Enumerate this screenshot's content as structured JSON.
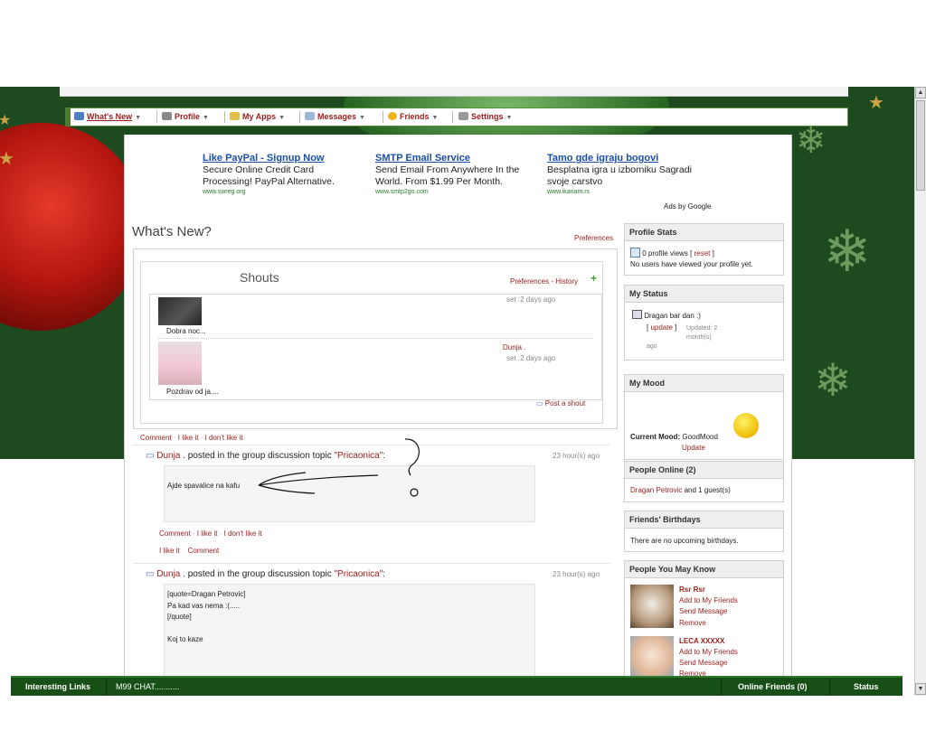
{
  "menubar": {
    "whats_new": "What's New",
    "profile": "Profile",
    "my_apps": "My Apps",
    "messages": "Messages",
    "friends": "Friends",
    "settings": "Settings"
  },
  "ads": [
    {
      "title": "Like PayPal - Signup Now",
      "text1": "Secure Online Credit Card",
      "text2": "Processing! PayPal Alternative.",
      "url": "www.swreg.org"
    },
    {
      "title": "SMTP Email Service",
      "text1": "Send Email From Anywhere In the",
      "text2": "World. From $1.99 Per Month.",
      "url": "www.smtp2go.com"
    },
    {
      "title": "Tamo gde igraju bogovi",
      "text1": "Besplatna igra u izborniku Sagradi",
      "text2": "svoje carstvo",
      "url": "www.ikariam.rs"
    }
  ],
  "ads_by_google": "Ads by Google",
  "main": {
    "heading": "What's New?",
    "preferences": "Preferences"
  },
  "shouts": {
    "title": "Shouts",
    "preferences": "Preferences",
    "history": "History",
    "items": [
      {
        "author": "",
        "time": "set :2 days ago",
        "text": "Dobra noc..."
      },
      {
        "author": "Dunja .",
        "time": "set :2 days ago",
        "text": "Pozdrav od ja...."
      }
    ],
    "post_shout": "Post a shout"
  },
  "actions": {
    "comment": "Comment",
    "like": "I like it",
    "dislike": "I don't like it",
    "sep": " · "
  },
  "posts": [
    {
      "author": "Dunja .",
      "verb": "posted in the group discussion topic",
      "topic": "\"Pricaonica\"",
      "colon": ":",
      "time": "23 hour(s) ago",
      "body": "Ajde spavalice na kafu"
    },
    {
      "author": "Dunja .",
      "verb": "posted in the group discussion topic",
      "topic": "\"Pricaonica\"",
      "colon": ":",
      "time": "23 hour(s) ago",
      "body_lines": [
        "[quote=Dragan Petrovic]",
        "Pa kad vas nema :(.....",
        "[/quote]",
        "",
        "Koj to kaze"
      ]
    }
  ],
  "post1_extra": {
    "like": "I like it",
    "comment": "Comment"
  },
  "sidebar": {
    "profile_stats": {
      "title": "Profile Stats",
      "views": "0 profile views [",
      "reset": "reset",
      "close": "]",
      "note": "No users have viewed your profile yet."
    },
    "my_status": {
      "title": "My Status",
      "status": "Dragan bar dan :)",
      "update": "update",
      "updated1": "Updated: 2",
      "updated2": "month(s)",
      "updated3": "ago"
    },
    "my_mood": {
      "title": "My Mood",
      "label": "Current Mood:",
      "mood": "GoodMood",
      "update": "Update"
    },
    "people_online": {
      "title": "People Online (2)",
      "name": "Dragan Petrovic",
      "rest": "and 1 guest(s)"
    },
    "birthdays": {
      "title": "Friends' Birthdays",
      "text": "There are no upcoming birthdays."
    },
    "people_you_may_know": {
      "title": "People You May Know",
      "people": [
        {
          "name": "Rsr Rsr",
          "add": "Add to My Friends",
          "msg": "Send Message",
          "remove": "Remove"
        },
        {
          "name": "LECA XXXXX",
          "add": "Add to My Friends",
          "msg": "Send Message",
          "remove": "Remove"
        }
      ]
    }
  },
  "bottombar": {
    "links": "Interesting Links",
    "chat": "M99 CHAT...........",
    "online": "Online Friends (0)",
    "status": "Status"
  },
  "colors": {
    "accent": "#9b1c1c",
    "link": "#1a4ea8",
    "bar": "#174f16"
  }
}
